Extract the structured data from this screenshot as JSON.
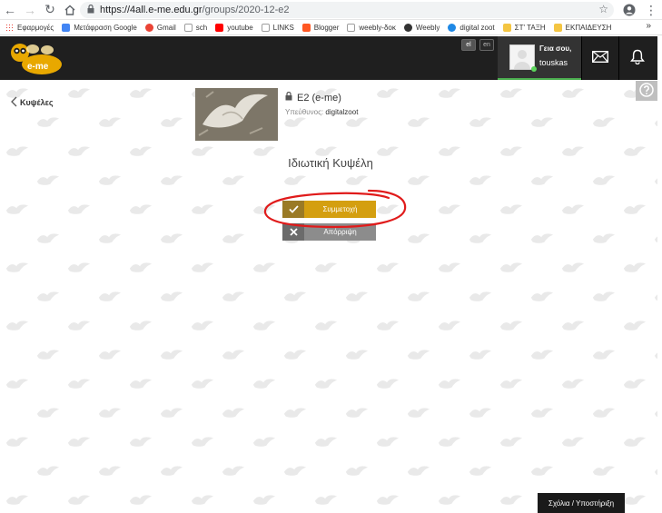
{
  "browser": {
    "url_host": "https://4all.e-me.edu.gr",
    "url_path": "/groups/2020-12-e2",
    "bookmarks": [
      {
        "label": "Εφαρμογές",
        "color": "#e8453c"
      },
      {
        "label": "Μετάφραση Google",
        "color": "#4285f4"
      },
      {
        "label": "Gmail",
        "color": "#ea4335"
      },
      {
        "label": "sch",
        "color": "#9e9e9e"
      },
      {
        "label": "youtube",
        "color": "#ff0000"
      },
      {
        "label": "LINKS",
        "color": "#9e9e9e"
      },
      {
        "label": "Blogger",
        "color": "#ff5722"
      },
      {
        "label": "weebly-δοκ",
        "color": "#9e9e9e"
      },
      {
        "label": "Weebly",
        "color": "#333333"
      },
      {
        "label": "digital zoot",
        "color": "#1e88e5"
      },
      {
        "label": "ΣΤ' ΤΑΞΗ",
        "color": "#f4c542"
      },
      {
        "label": "ΕΚΠΑΙΔΕΥΣΗ",
        "color": "#f4c542"
      }
    ],
    "more_label": "»"
  },
  "header": {
    "logo_text": "e-me",
    "lang_el": "el",
    "lang_en": "en",
    "greeting": "Γεια σου,",
    "username": "touskas"
  },
  "hive": {
    "back_label": "Κυψέλες",
    "title": "E2 (e-me)",
    "owner_label": "Υπεύθυνος:",
    "owner_name": "digitalzoot",
    "heading": "Ιδιωτική Κυψέλη",
    "join_label": "Συμμετοχή",
    "decline_label": "Απόρριψη"
  },
  "footer": {
    "feedback_label": "Σχόλια / Υποστήριξη"
  },
  "colors": {
    "header_bg": "#1f1f1f",
    "join": "#d49f10",
    "decline": "#8c8c8c",
    "annotation": "#e01b1b",
    "online": "#5cd65c"
  }
}
